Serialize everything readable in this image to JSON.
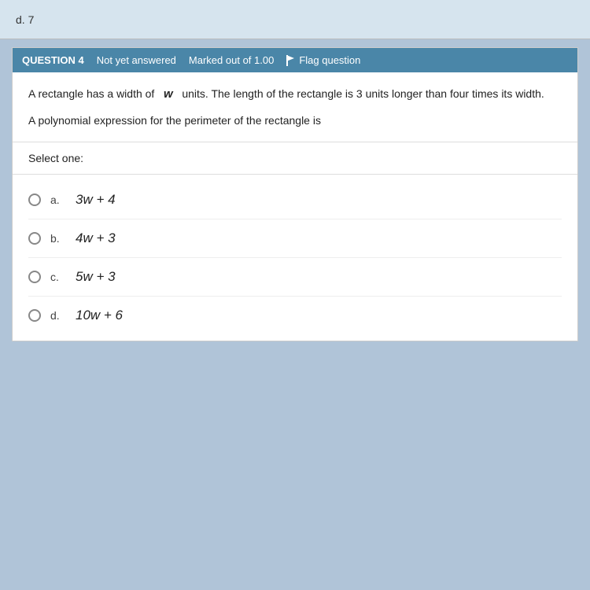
{
  "topBar": {
    "text": "d. 7"
  },
  "question": {
    "number": "QUESTION 4",
    "status": "Not yet answered",
    "marked": "Marked out of 1.00",
    "flagLabel": "Flag question",
    "bodyText1": "A rectangle has a width of",
    "variable": "w",
    "bodyText2": "units. The length of the rectangle is 3 units longer than four times its width.",
    "bodyText3": "A polynomial expression for the perimeter of the rectangle is",
    "selectLabel": "Select one:",
    "options": [
      {
        "id": "a",
        "label": "a.",
        "math": "3w + 4"
      },
      {
        "id": "b",
        "label": "b.",
        "math": "4w + 3"
      },
      {
        "id": "c",
        "label": "c.",
        "math": "5w + 3"
      },
      {
        "id": "d",
        "label": "d.",
        "math": "10w + 6"
      }
    ]
  }
}
